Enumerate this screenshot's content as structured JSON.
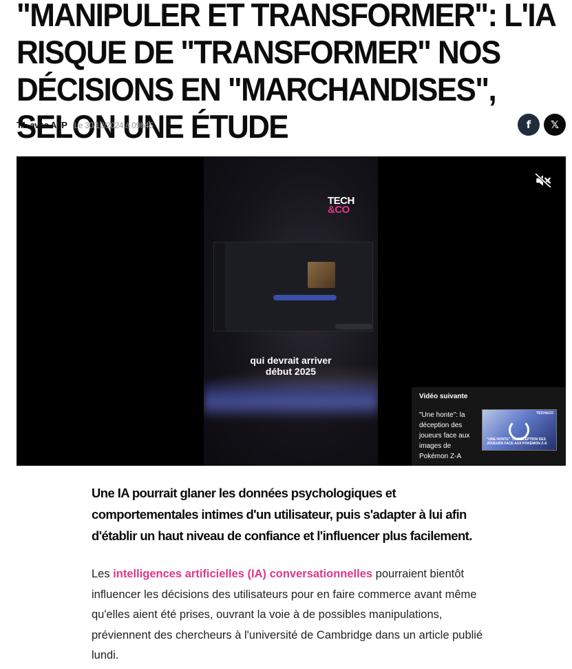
{
  "article": {
    "title": "\"MANIPULER ET TRANSFORMER\": L'IA RISQUE DE \"TRANSFORMER\" NOS DÉCISIONS EN \"MARCHANDISES\", SELON UNE ÉTUDE",
    "author": "T.L avec AFP",
    "date": "Le 30/12/2024 à 09h45",
    "lead": "Une IA pourrait glaner les données psychologiques et comportementales intimes d'un utilisateur, puis s'adapter à lui afin d'établir un haut niveau de confiance et l'influencer plus facilement.",
    "para1_prefix": "Les ",
    "para1_link": "intelligences artificielles (IA) conversationnelles",
    "para1_suffix": " pourraient bientôt influencer les décisions des utilisateurs pour en faire commerce avant même qu'elles aient été prises, ouvrant la voie à de possibles manipulations, préviennent des chercheurs à l'université de Cambridge dans un article publié lundi."
  },
  "share": {
    "facebook_icon": "facebook-icon",
    "facebook_glyph": "f",
    "x_icon": "x-icon",
    "x_glyph": "𝕏"
  },
  "video": {
    "logo_line1": "TECH",
    "logo_line2": "&CO",
    "caption_line1": "qui devrait arriver",
    "caption_line2": "début 2025",
    "mute_icon": "volume-muted-icon",
    "next": {
      "label": "Vidéo suivante",
      "title": "\"Une honte\": la déception des joueurs face aux images de Pokémon Z-A",
      "thumb_text": "\"UNE HONTE\": LA DÉCEPTION DES JOUEURS FACE AUX POKÉMON Z-A",
      "thumb_logo": "TECH&CO"
    }
  },
  "colors": {
    "accent": "#e0368a",
    "facebook_bg": "#1f2d3d",
    "x_bg": "#0a0a0a",
    "player_bg": "#000000"
  }
}
